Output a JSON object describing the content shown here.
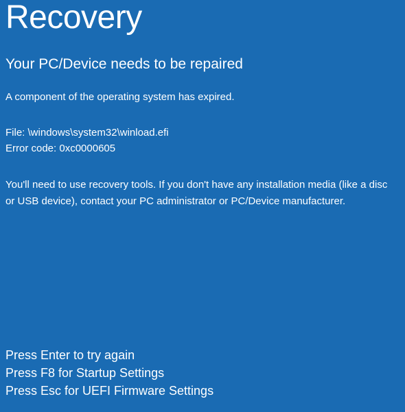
{
  "title": "Recovery",
  "subtitle": "Your PC/Device needs to be repaired",
  "message": "A component of the operating system has expired.",
  "file": {
    "label": "File:",
    "path": "\\windows\\system32\\winload.efi"
  },
  "error": {
    "label": "Error code:",
    "code": "0xc0000605"
  },
  "instructions": "You'll need to use recovery tools. If you don't have any installation media (like a disc or USB device), contact your PC administrator or PC/Device manufacturer.",
  "actions": {
    "enter": "Press Enter to try again",
    "f8": "Press F8 for Startup Settings",
    "esc": "Press Esc for UEFI Firmware Settings"
  }
}
